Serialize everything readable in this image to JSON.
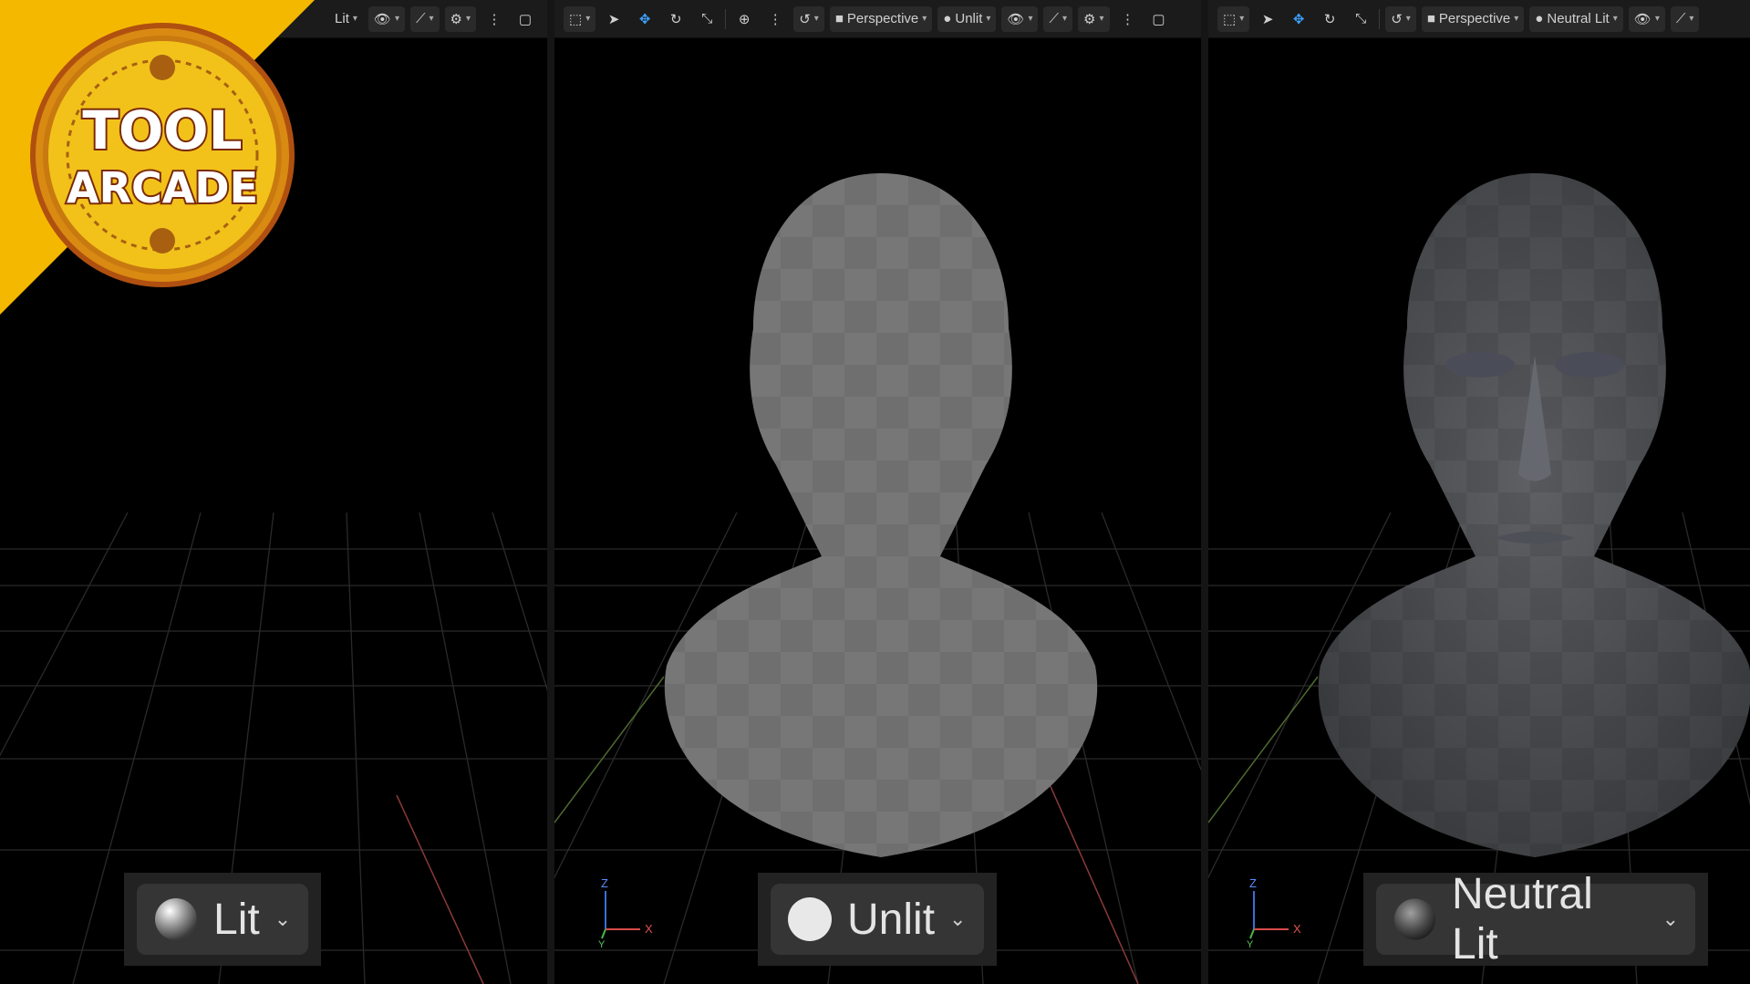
{
  "viewports": [
    {
      "toolbar": {
        "shading_label": "Lit"
      },
      "shading_mode": {
        "label": "Lit",
        "icon": "lit-sphere-icon"
      }
    },
    {
      "toolbar": {
        "view_label": "Perspective",
        "shading_label": "Unlit"
      },
      "shading_mode": {
        "label": "Unlit",
        "icon": "unlit-circle-icon"
      },
      "axis": {
        "z": "Z",
        "x": "X",
        "y": "Y"
      }
    },
    {
      "toolbar": {
        "view_label": "Perspective",
        "shading_label": "Neutral Lit"
      },
      "shading_mode": {
        "label": "Neutral Lit",
        "icon": "neutral-lit-sphere-icon"
      },
      "axis": {
        "z": "Z",
        "x": "X",
        "y": "Y"
      }
    }
  ],
  "logo": {
    "line1": "TOOL",
    "line2": "ARCADE"
  },
  "colors": {
    "background": "#000000",
    "toolbar": "#1b1b1b",
    "accent_blue": "#3da2ff",
    "logo_gold": "#f5b800",
    "bust_unlit": "#777777",
    "bust_neutral": "#5c5e62"
  }
}
